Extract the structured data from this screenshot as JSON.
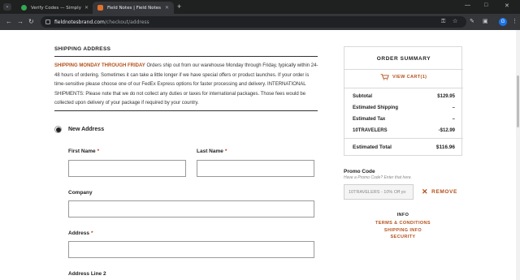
{
  "browser": {
    "tabs": [
      {
        "label": "Verify Codes — SimplyCodes",
        "active": false
      },
      {
        "label": "Field Notes | Field Notes",
        "active": true
      }
    ],
    "url_domain": "fieldnotesbrand.com",
    "url_path": "/checkout/address",
    "profile_initial": "G"
  },
  "address_section": {
    "title": "SHIPPING ADDRESS",
    "notice_highlight": "Shipping Monday through Friday",
    "notice_text": " Orders ship out from our warehouse Monday through Friday, typically within 24-48 hours of ordering. Sometimes it can take a little longer if we have special offers or product launches. If your order is time-sensitive please choose one of our FedEx Express options for faster processing and delivery. INTERNATIONAL SHIPMENTS: Please note that we do not collect any duties or taxes for international packages. Those fees would be collected upon delivery of your package if required by your country.",
    "new_address_label": "New Address"
  },
  "form": {
    "first_name_label": "First Name",
    "last_name_label": "Last Name",
    "company_label": "Company",
    "address_label": "Address",
    "address2_label": "Address Line 2",
    "required_mark": "*"
  },
  "summary": {
    "title": "ORDER SUMMARY",
    "view_cart": "VIEW CART(1)",
    "rows": [
      {
        "label": "Subtotal",
        "value": "$129.95"
      },
      {
        "label": "Estimated Shipping",
        "value": "–"
      },
      {
        "label": "Estimated Tax",
        "value": "–"
      },
      {
        "label": "10TRAVELERS",
        "value": "-$12.99"
      }
    ],
    "total_label": "Estimated Total",
    "total_value": "$116.96"
  },
  "promo": {
    "title": "Promo Code",
    "hint": "Have a Promo Code? Enter that here.",
    "applied_value": "10TRAVELERS - 10% Off yo",
    "remove_label": "REMOVE"
  },
  "footer": {
    "info_heading": "INFO",
    "links": [
      "TERMS & CONDITIONS",
      "SHIPPING INFO",
      "SECURITY"
    ]
  },
  "colors": {
    "accent": "#b4501a",
    "required": "#c0392b"
  }
}
